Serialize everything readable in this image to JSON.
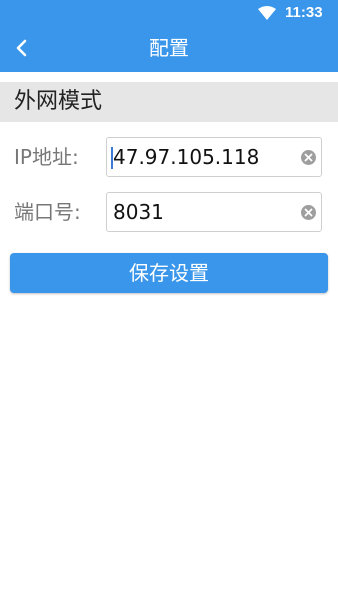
{
  "status_bar": {
    "time": "11:33",
    "icons": [
      "wifi-icon"
    ]
  },
  "toolbar": {
    "back_icon": "chevron-left-icon",
    "title": "配置"
  },
  "section": {
    "title": "外网模式"
  },
  "form": {
    "ip": {
      "label": "IP地址:",
      "value": "47.97.105.118"
    },
    "port": {
      "label": "端口号:",
      "value": "8031"
    },
    "clear_icon": "clear-icon"
  },
  "actions": {
    "save_label": "保存设置"
  },
  "colors": {
    "accent": "#3a96ea",
    "section_bg": "#e6e6e6",
    "label": "#777777"
  }
}
